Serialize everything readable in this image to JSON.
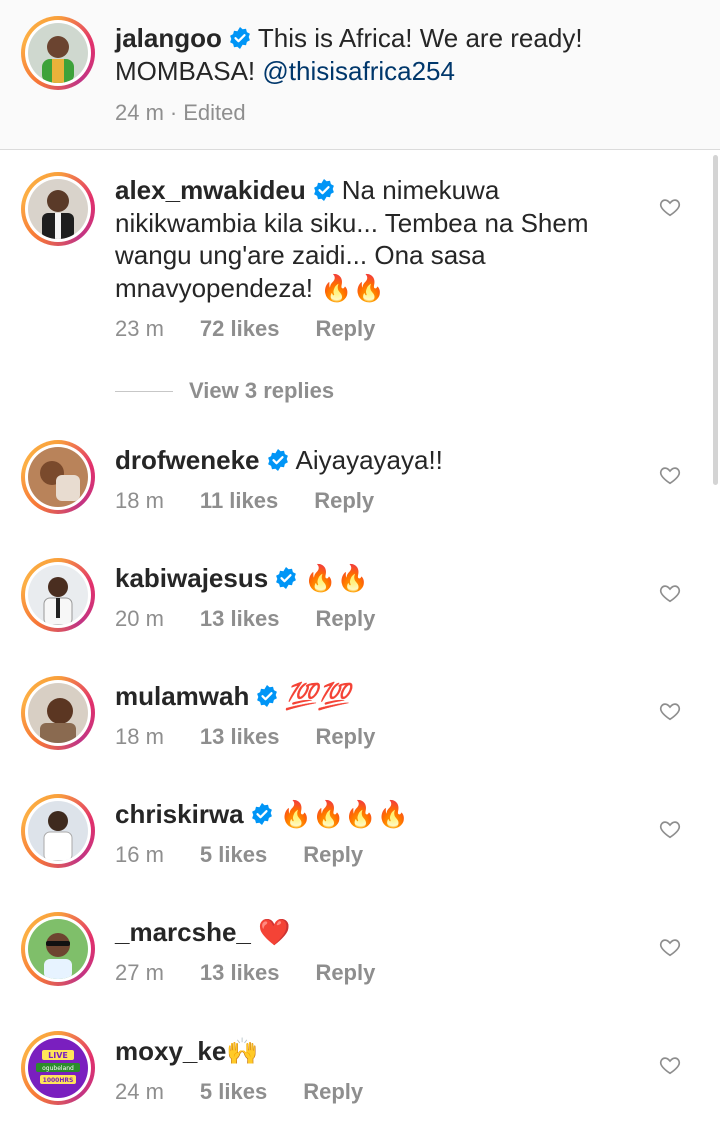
{
  "caption": {
    "username": "jalangoo",
    "text_line1": "This is Africa! We are ready!",
    "text_line2_prefix": "MOMBASA!",
    "mention": "@thisisafrica254",
    "time": "24 m",
    "separator": "·",
    "edited": "Edited"
  },
  "comments": [
    {
      "username": "alex_mwakideu",
      "text": "Na nimekuwa nikikwambia kila siku... Tembea na Shem wangu ung'are zaidi... Ona sasa mnavyopendeza! 🔥🔥",
      "time": "23 m",
      "likes": "72 likes",
      "reply": "Reply",
      "verified": true
    },
    {
      "username": "drofweneke",
      "text": "Aiyayayaya!!",
      "time": "18 m",
      "likes": "11 likes",
      "reply": "Reply",
      "verified": true
    },
    {
      "username": "kabiwajesus",
      "text": "🔥🔥",
      "time": "20 m",
      "likes": "13 likes",
      "reply": "Reply",
      "verified": true
    },
    {
      "username": "mulamwah",
      "text": "💯💯",
      "time": "18 m",
      "likes": "13 likes",
      "reply": "Reply",
      "verified": true
    },
    {
      "username": "chriskirwa",
      "text": "🔥🔥🔥🔥",
      "time": "16 m",
      "likes": "5 likes",
      "reply": "Reply",
      "verified": true
    },
    {
      "username": "_marcshe_",
      "text": "❤️",
      "time": "27 m",
      "likes": "13 likes",
      "reply": "Reply",
      "verified": false
    },
    {
      "username": "moxy_ke",
      "text": "🙌",
      "time": "24 m",
      "likes": "5 likes",
      "reply": "Reply",
      "verified": false
    }
  ],
  "view_replies": "View 3 replies",
  "moxy_avatar_text": [
    "LIVE",
    "ogubeland",
    "1000HRS"
  ],
  "colors": {
    "verified": "#0095f6",
    "mention": "#00376b",
    "meta": "#8e8e8e"
  }
}
